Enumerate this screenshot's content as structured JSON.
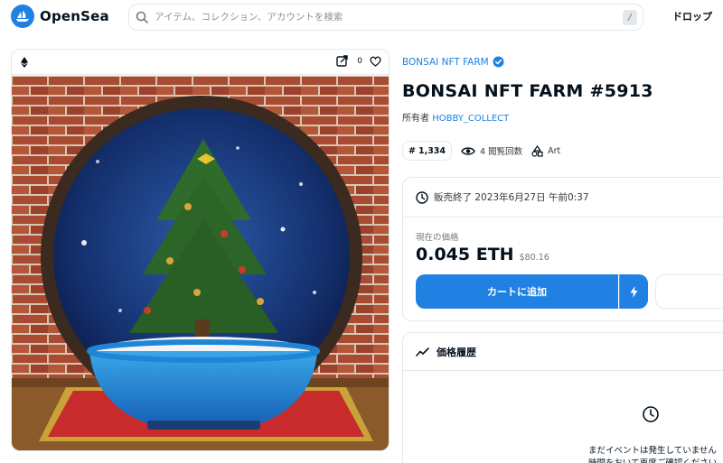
{
  "header": {
    "logo_text": "OpenSea",
    "search_placeholder": "アイテム、コレクション、アカウントを検索",
    "search_shortcut": "/",
    "nav_drops": "ドロップ"
  },
  "card": {
    "favorite_count": "0",
    "icons": [
      "ethereum-icon",
      "external-link-icon",
      "heart-icon"
    ]
  },
  "item": {
    "collection_name": "BONSAI NFT FARM",
    "title": "BONSAI NFT FARM #5913",
    "owner_label": "所有者",
    "owner_name": "HOBBY_COLLECT",
    "rank": "1,334",
    "views": "4 閲覧回数",
    "category": "Art"
  },
  "sale": {
    "end_text": "販売終了 2023年6月27日 午前0:37",
    "price_label": "現在の価格",
    "price_eth": "0.045 ETH",
    "price_usd": "$80.16",
    "cart_button": "カートに追加"
  },
  "history": {
    "title": "価格履歴",
    "empty_line1": "まだイベントは発生していません",
    "empty_line2": "時間をおいて再度ご確認ください。"
  },
  "colors": {
    "accent": "#2081e2",
    "text": "#04111d",
    "border": "#e5e8eb"
  }
}
